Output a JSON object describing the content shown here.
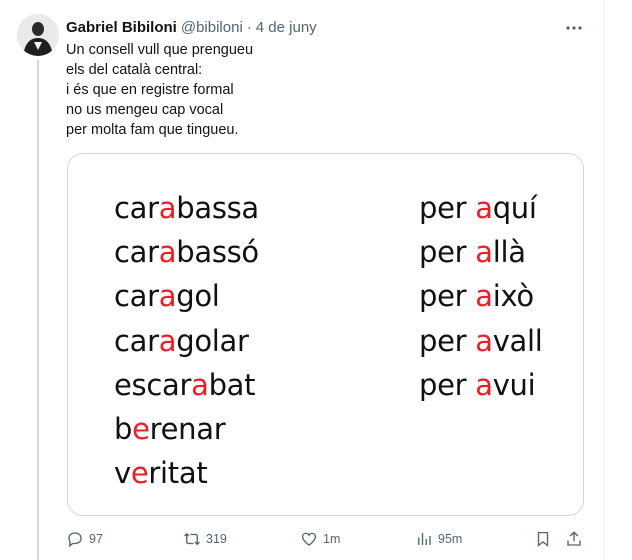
{
  "author": {
    "name": "Gabriel Bibiloni",
    "handle": "@bibiloni",
    "separator": "·",
    "date": "4 de juny"
  },
  "tweet": {
    "lines": [
      "Un consell vull que prengueu",
      "els del català central:",
      "i és que en registre formal",
      "no us mengeu cap vocal",
      "per molta fam que tingueu."
    ]
  },
  "image": {
    "left_words": [
      {
        "pre": "car",
        "hl": "a",
        "post": "bassa"
      },
      {
        "pre": "car",
        "hl": "a",
        "post": "bassó"
      },
      {
        "pre": "car",
        "hl": "a",
        "post": "gol"
      },
      {
        "pre": "car",
        "hl": "a",
        "post": "golar"
      },
      {
        "pre": "escar",
        "hl": "a",
        "post": "bat"
      },
      {
        "pre": "b",
        "hl": "e",
        "post": "renar"
      },
      {
        "pre": "v",
        "hl": "e",
        "post": "ritat"
      }
    ],
    "right_words": [
      {
        "pre": "per ",
        "hl": "a",
        "post": "quí"
      },
      {
        "pre": "per ",
        "hl": "a",
        "post": "llà"
      },
      {
        "pre": "per ",
        "hl": "a",
        "post": "ixò"
      },
      {
        "pre": "per ",
        "hl": "a",
        "post": "vall"
      },
      {
        "pre": "per ",
        "hl": "a",
        "post": "vui"
      }
    ],
    "highlight_color": "#ee1c24"
  },
  "actions": {
    "replies": "97",
    "retweets": "319",
    "likes": "1m",
    "views": "95m"
  },
  "icons": {
    "more": "more-dots-icon",
    "reply": "reply-bubble-icon",
    "retweet": "retweet-icon",
    "like": "heart-icon",
    "views": "bar-chart-icon",
    "bookmark": "bookmark-icon",
    "share": "share-upload-icon"
  }
}
